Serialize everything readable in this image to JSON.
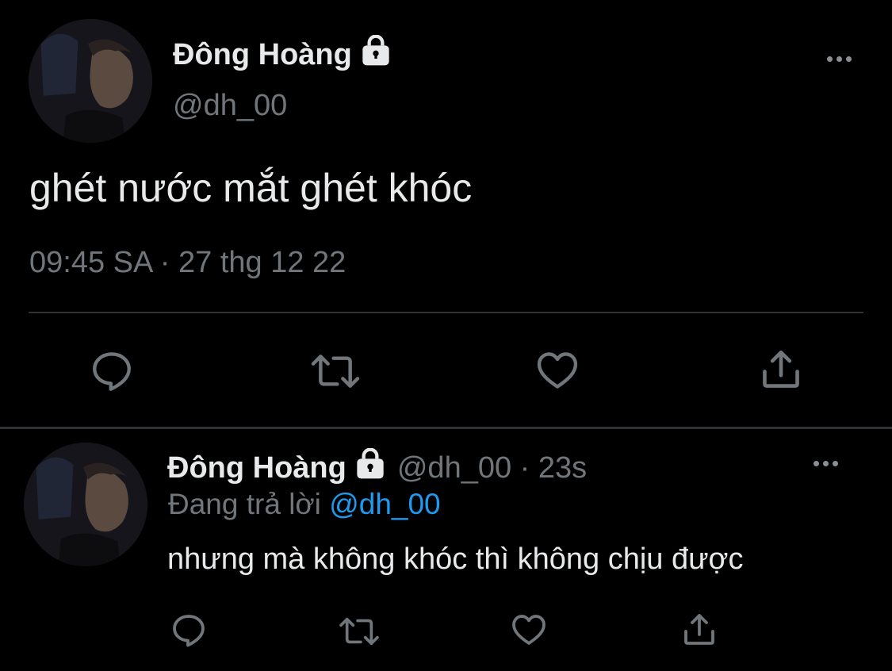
{
  "main_tweet": {
    "display_name": "Đông Hoàng",
    "handle": "@dh_00",
    "text": "ghét nước mắt ghét khóc",
    "timestamp": "09:45 SA · 27 thg 12 22"
  },
  "reply_tweet": {
    "display_name": "Đông Hoàng",
    "meta": "@dh_00 · 23s",
    "replying_prefix": "Đang trả lời",
    "replying_to": "@dh_00",
    "text": "nhưng mà không khóc thì không chịu được"
  },
  "icons": {
    "protected": "lock-icon",
    "more": "more-horizontal-icon",
    "reply": "reply-bubble-icon",
    "retweet": "retweet-icon",
    "like": "heart-icon",
    "share": "share-icon"
  },
  "colors": {
    "background": "#000000",
    "text": "#e7e9ea",
    "muted": "#71767b",
    "mention": "#1d9bf0",
    "divider": "#2f3336",
    "icon": "#71767b"
  }
}
